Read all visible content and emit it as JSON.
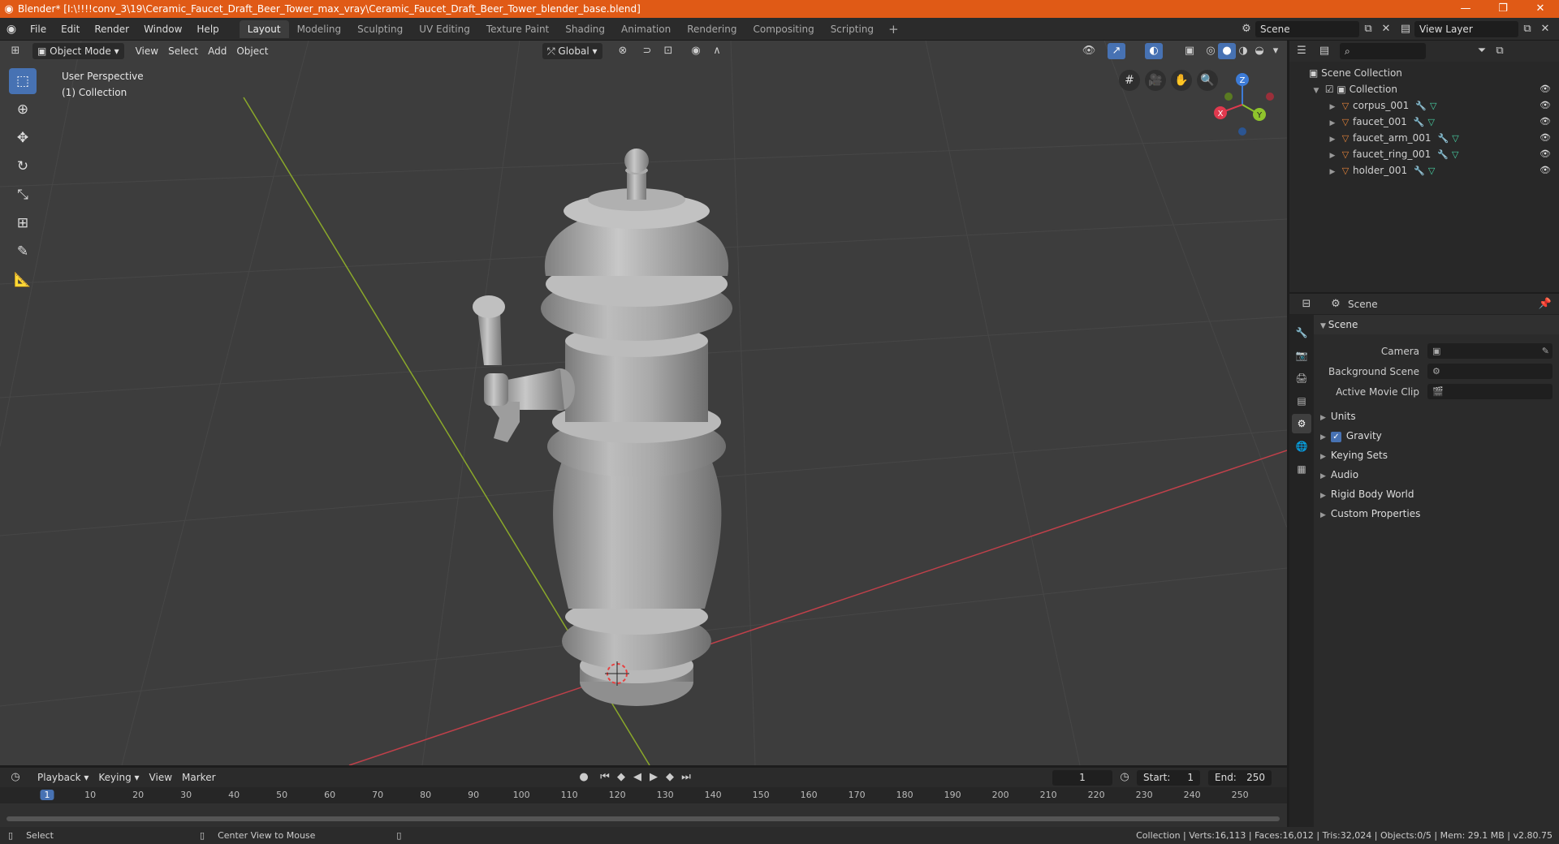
{
  "window": {
    "title": "Blender* [I:\\!!!!conv_3\\19\\Ceramic_Faucet_Draft_Beer_Tower_max_vray\\Ceramic_Faucet_Draft_Beer_Tower_blender_base.blend]",
    "minimize": "—",
    "maximize": "❐",
    "close": "✕"
  },
  "menu": [
    "File",
    "Edit",
    "Render",
    "Window",
    "Help"
  ],
  "workspaces": [
    "Layout",
    "Modeling",
    "Sculpting",
    "UV Editing",
    "Texture Paint",
    "Shading",
    "Animation",
    "Rendering",
    "Compositing",
    "Scripting"
  ],
  "workspace_add": "+",
  "scene_field": "Scene",
  "view_layer_field": "View Layer",
  "viewport": {
    "mode": "Object Mode",
    "menus": [
      "View",
      "Select",
      "Add",
      "Object"
    ],
    "transform_orientation": "Global",
    "perspective_label": "User Perspective",
    "collection_label": "(1) Collection",
    "gizmo_axes": {
      "x": "X",
      "y": "Y",
      "z": "Z"
    }
  },
  "outliner": {
    "root": "Scene Collection",
    "collection": "Collection",
    "objects": [
      "corpus_001",
      "faucet_001",
      "faucet_arm_001",
      "faucet_ring_001",
      "holder_001"
    ]
  },
  "properties": {
    "header": "Scene",
    "panel": "Scene",
    "rows": [
      {
        "label": "Camera"
      },
      {
        "label": "Background Scene"
      },
      {
        "label": "Active Movie Clip"
      }
    ],
    "subpanels": [
      "Units",
      "Gravity",
      "Keying Sets",
      "Audio",
      "Rigid Body World",
      "Custom Properties"
    ]
  },
  "timeline": {
    "menus": [
      "Playback",
      "Keying",
      "View",
      "Marker"
    ],
    "current_frame": "1",
    "start_label": "Start:",
    "start": "1",
    "end_label": "End:",
    "end": "250",
    "ruler": [
      "1",
      "10",
      "20",
      "30",
      "40",
      "50",
      "60",
      "70",
      "80",
      "90",
      "100",
      "110",
      "120",
      "130",
      "140",
      "150",
      "160",
      "170",
      "180",
      "190",
      "200",
      "210",
      "220",
      "230",
      "240",
      "250"
    ]
  },
  "status": {
    "left": "Select",
    "middle": "Center View to Mouse",
    "stats": "Collection | Verts:16,113 | Faces:16,012 | Tris:32,024 | Objects:0/5 | Mem: 29.1 MB | v2.80.75"
  },
  "colors": {
    "title_bar": "#e05a16",
    "accent": "#4772b3",
    "viewport_bg": "#3d3d3d",
    "axis_x": "#c0404a",
    "axis_y": "#8aa82a",
    "mesh_icon": "#e6843a"
  }
}
